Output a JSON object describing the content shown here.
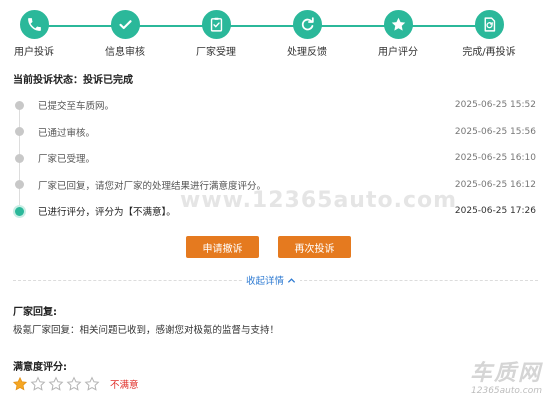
{
  "steps": [
    {
      "label": "用户投诉",
      "icon": "phone-icon"
    },
    {
      "label": "信息审核",
      "icon": "check-icon"
    },
    {
      "label": "厂家受理",
      "icon": "clipboard-icon"
    },
    {
      "label": "处理反馈",
      "icon": "refresh-icon"
    },
    {
      "label": "用户评分",
      "icon": "star-icon"
    },
    {
      "label": "完成/再投诉",
      "icon": "document-icon"
    }
  ],
  "status": {
    "text": "当前投诉状态：投诉已完成"
  },
  "timeline": [
    {
      "text": "已提交至车质网。",
      "time": "2025-06-25 15:52"
    },
    {
      "text": "已通过审核。",
      "time": "2025-06-25 15:56"
    },
    {
      "text": "厂家已受理。",
      "time": "2025-06-25 16:10"
    },
    {
      "text": "厂家已回复，请您对厂家的处理结果进行满意度评分。",
      "time": "2025-06-25 16:12"
    },
    {
      "text": "已进行评分，评分为【不满意】。",
      "time": "2025-06-25 17:26"
    }
  ],
  "watermark": "www.12365auto.com",
  "buttons": {
    "withdraw": "申请撤诉",
    "recomplain": "再次投诉"
  },
  "collapse": {
    "label": "收起详情"
  },
  "reply": {
    "title": "厂家回复:",
    "text": "极氪厂家回复：相关问题已收到，感谢您对极氪的监督与支持！"
  },
  "rating": {
    "title": "满意度评分:",
    "stars_filled": 1,
    "stars_total": 5,
    "text": "不满意"
  },
  "logo": {
    "main": "车质网",
    "url": "12365auto.com"
  },
  "colors": {
    "accent": "#2bb89a",
    "button": "#e57a1f",
    "link": "#2d7ad2",
    "alert": "#e0302b"
  }
}
